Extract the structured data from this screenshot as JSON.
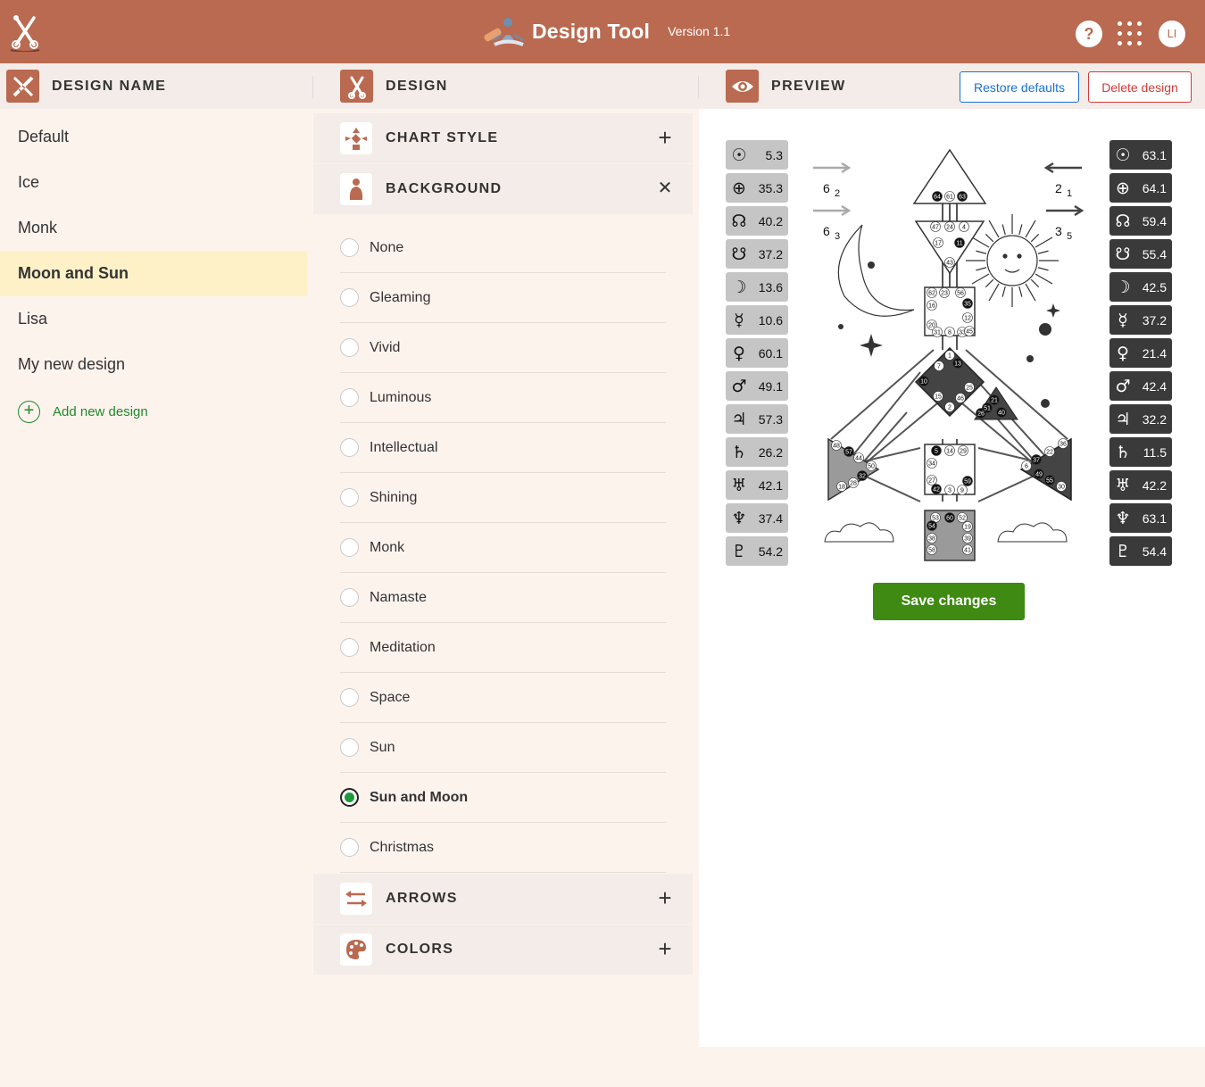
{
  "app": {
    "title": "Design Tool",
    "version": "Version 1.1",
    "help_label": "?",
    "avatar_initials": "LI",
    "accent_color": "#b96a50"
  },
  "headers": {
    "design_name": "DESIGN NAME",
    "design": "DESIGN",
    "preview": "PREVIEW",
    "restore_defaults": "Restore defaults",
    "delete_design": "Delete design"
  },
  "designs": {
    "items": [
      "Default",
      "Ice",
      "Monk",
      "Moon and Sun",
      "Lisa",
      "My new design"
    ],
    "selected": "Moon and Sun",
    "add_label": "Add new design"
  },
  "sections": {
    "chart_style": "CHART STYLE",
    "background": "BACKGROUND",
    "arrows": "ARROWS",
    "colors": "COLORS"
  },
  "background_options": {
    "items": [
      "None",
      "Gleaming",
      "Vivid",
      "Luminous",
      "Intellectual",
      "Shining",
      "Monk",
      "Namaste",
      "Meditation",
      "Space",
      "Sun",
      "Sun and Moon",
      "Christmas"
    ],
    "selected": "Sun and Moon"
  },
  "preview": {
    "left_planets": [
      "5.3",
      "35.3",
      "40.2",
      "37.2",
      "13.6",
      "10.6",
      "60.1",
      "49.1",
      "57.3",
      "26.2",
      "42.1",
      "37.4",
      "54.2"
    ],
    "right_planets": [
      "63.1",
      "64.1",
      "59.4",
      "55.4",
      "42.5",
      "37.2",
      "21.4",
      "42.4",
      "32.2",
      "11.5",
      "42.2",
      "63.1",
      "54.4"
    ],
    "planet_icons": [
      "sun-icon",
      "earth-icon",
      "north-node-icon",
      "south-node-icon",
      "moon-icon",
      "mercury-icon",
      "venus-icon",
      "mars-icon",
      "jupiter-icon",
      "saturn-icon",
      "uranus-icon",
      "neptune-icon",
      "pluto-icon"
    ],
    "arrows": {
      "top_left": {
        "base": "6",
        "sub": "2"
      },
      "bottom_left": {
        "base": "6",
        "sub": "3"
      },
      "top_right": {
        "base": "2",
        "sub": "1"
      },
      "bottom_right": {
        "base": "3",
        "sub": "5"
      }
    },
    "gates": {
      "head": [
        "64",
        "61",
        "63"
      ],
      "ajna": [
        "47",
        "24",
        "4",
        "17",
        "11",
        "43"
      ],
      "throat": [
        "62",
        "23",
        "56",
        "16",
        "35",
        "20",
        "12",
        "31",
        "8",
        "33",
        "45"
      ],
      "g": [
        "1",
        "7",
        "13",
        "10",
        "25",
        "15",
        "46",
        "2"
      ],
      "heart": [
        "21",
        "51",
        "26",
        "40"
      ],
      "sacral": [
        "5",
        "14",
        "29",
        "34",
        "27",
        "59",
        "42",
        "3",
        "9"
      ],
      "root": [
        "53",
        "60",
        "52",
        "54",
        "19",
        "38",
        "39",
        "58",
        "41"
      ],
      "spleen": [
        "48",
        "57",
        "44",
        "50",
        "32",
        "28",
        "18"
      ],
      "solar_plexus": [
        "36",
        "22",
        "37",
        "6",
        "49",
        "55",
        "30"
      ]
    },
    "save_label": "Save changes"
  }
}
